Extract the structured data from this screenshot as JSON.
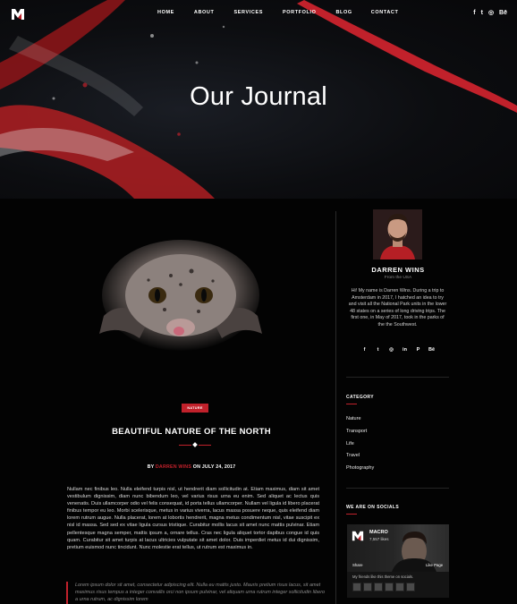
{
  "nav": {
    "items": [
      "HOME",
      "ABOUT",
      "SERVICES",
      "PORTFOLIO",
      "BLOG",
      "CONTACT"
    ]
  },
  "social_icons": [
    "facebook-icon",
    "twitter-icon",
    "instagram-icon",
    "behance-icon"
  ],
  "social_glyphs": [
    "f",
    "t",
    "◎",
    "Bē"
  ],
  "hero": {
    "title": "Our Journal"
  },
  "post": {
    "category": "NATURE",
    "title": "BEAUTIFUL NATURE OF THE NORTH",
    "by": "BY",
    "author": "DARREN WINS",
    "on": "ON",
    "date": "JULY 24, 2017",
    "body": "Nullam nec finibus leo. Nulla eleifend turpis nisl, ut hendrerit diam sollicitudin at. Etiam maximus, diam sit amet vestibulum dignissim, diam nunc bibendum leo, vel varius risus urna eu enim. Sed aliquet ac lectus quis venenatis. Duis ullamcorper odio vel felis consequat, id porta tellus ullamcorper. Nullam vel ligula id libero placerat finibus tempor eu leo. Morbi scelerisque, metus in varius viverra, lacus massa posuere neque, quis eleifend diam lorem rutrum augue. Nulla placerat, lorem at lobortis hendrerit, magna metus condimentum nisl, vitae suscipit ex nisl id massa. Sed sed ex vitae ligula cursus tristique. Curabitur mollis lacus sit amet nunc mattis pulvinar. Etiam pellentesque magna semper, mattis ipsum a, ornare tellus. Cras nec ligula aliquet tortor dapibus congue id quis quam. Curabitur sit amet turpis at lacus ultricies vulputate sit amet dolor. Duis imperdiet metus id dui dignissim, pretium euismod nunc tincidunt. Nunc molestie erat tellus, ut rutrum est maximus in.",
    "quote": "Lorem ipsum dolor sit amet, consectetur adipiscing elit. Nulla eu mattis justo. Mauris pretium risus lacus, sit amet maximus risus tempus a integer convallis orci non ipsum pulvinar, vel aliquam urna rutrum integer sollicitudin libero a urna rutrum, ac dignissim lorem"
  },
  "sidebar": {
    "author_name": "DARREN WINS",
    "author_from": "From the USA",
    "bio": "Hi! My name is Darren Wins. During a trip to Amsterdam in 2017, I hatched an idea to try and visit all the National Park units in the lower 48 states on a series of long driving trips. The first one, in May of 2017, took in the parks of the the Southwest.",
    "social_glyphs": [
      "f",
      "t",
      "◎",
      "in",
      "P",
      "Bē"
    ],
    "category_title": "CATEGORY",
    "categories": [
      "Nature",
      "Transport",
      "Life",
      "Travel",
      "Photography"
    ],
    "socials_title": "WE ARE ON SOCIALS",
    "fb": {
      "name": "MACRO",
      "likes": "7,557 likes",
      "share": "Share",
      "like": "Like Page",
      "friends": "My friends like this theme on socials."
    }
  },
  "colors": {
    "accent": "#c1212b",
    "background": "#030303"
  }
}
